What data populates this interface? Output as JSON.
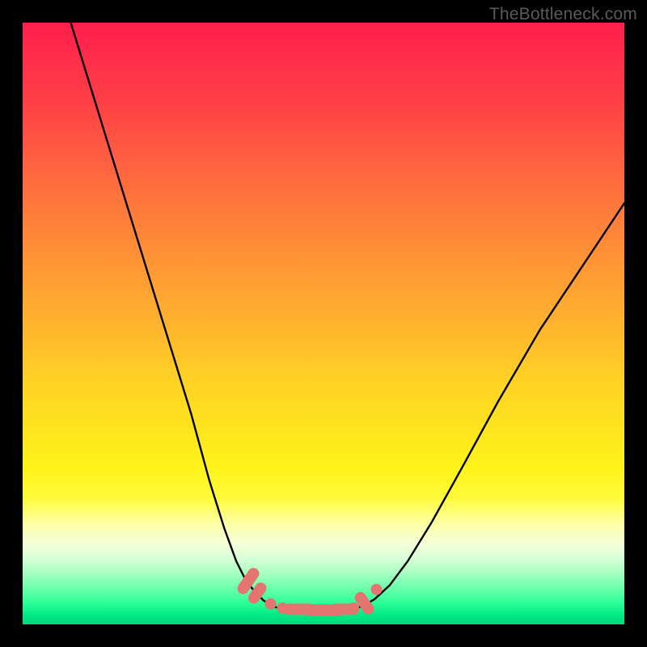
{
  "watermark": "TheBottleneck.com",
  "colors": {
    "frame_bg": "#000000",
    "curve_stroke": "#000000",
    "marker_fill": "#e47470",
    "marker_stroke": "#d8605c"
  },
  "chart_data": {
    "type": "line",
    "title": "",
    "xlabel": "",
    "ylabel": "",
    "xlim": [
      0,
      100
    ],
    "ylim": [
      0,
      100
    ],
    "grid": false,
    "legend": false,
    "note": "V-shaped bottleneck curve over vertical green→red gradient. No numeric axis ticks visible; x/y values are positional estimates (0–100 each, y=0 at bottom).",
    "series": [
      {
        "name": "left-arm",
        "x": [
          8,
          12,
          16,
          20,
          24,
          28,
          31,
          33.5,
          35.5,
          37,
          38.5,
          40,
          41.5,
          43
        ],
        "y": [
          100,
          87,
          74,
          61,
          48,
          35,
          24,
          16,
          10.5,
          7.5,
          5.5,
          4,
          3,
          2.6
        ]
      },
      {
        "name": "valley",
        "x": [
          43,
          45,
          47,
          49,
          51,
          53,
          55,
          56.5
        ],
        "y": [
          2.6,
          2.4,
          2.3,
          2.3,
          2.3,
          2.4,
          2.6,
          3.0
        ]
      },
      {
        "name": "right-arm",
        "x": [
          56.5,
          58.5,
          61,
          64,
          68,
          73,
          79,
          86,
          94,
          100
        ],
        "y": [
          3.0,
          4.2,
          6.5,
          10.5,
          17,
          26,
          37,
          49,
          61,
          70
        ]
      }
    ],
    "markers": {
      "name": "bottleneck-range-markers",
      "note": "Salmon pill-shaped markers along the valley floor and lower arms.",
      "points": [
        {
          "x": 37.5,
          "y": 7.2,
          "shape": "pill-diag",
          "len": 3.0
        },
        {
          "x": 39.0,
          "y": 5.2,
          "shape": "pill-diag",
          "len": 2.0
        },
        {
          "x": 41.2,
          "y": 3.4,
          "shape": "dot"
        },
        {
          "x": 43.2,
          "y": 2.7,
          "shape": "dot"
        },
        {
          "x": 46.0,
          "y": 2.5,
          "shape": "pill-h",
          "len": 3.5
        },
        {
          "x": 50.0,
          "y": 2.4,
          "shape": "pill-h",
          "len": 5.0
        },
        {
          "x": 53.5,
          "y": 2.5,
          "shape": "pill-h",
          "len": 3.0
        },
        {
          "x": 55.0,
          "y": 2.7,
          "shape": "dot"
        },
        {
          "x": 56.8,
          "y": 3.5,
          "shape": "pill-diag-r",
          "len": 2.3
        },
        {
          "x": 58.8,
          "y": 5.8,
          "shape": "dot"
        }
      ]
    }
  }
}
